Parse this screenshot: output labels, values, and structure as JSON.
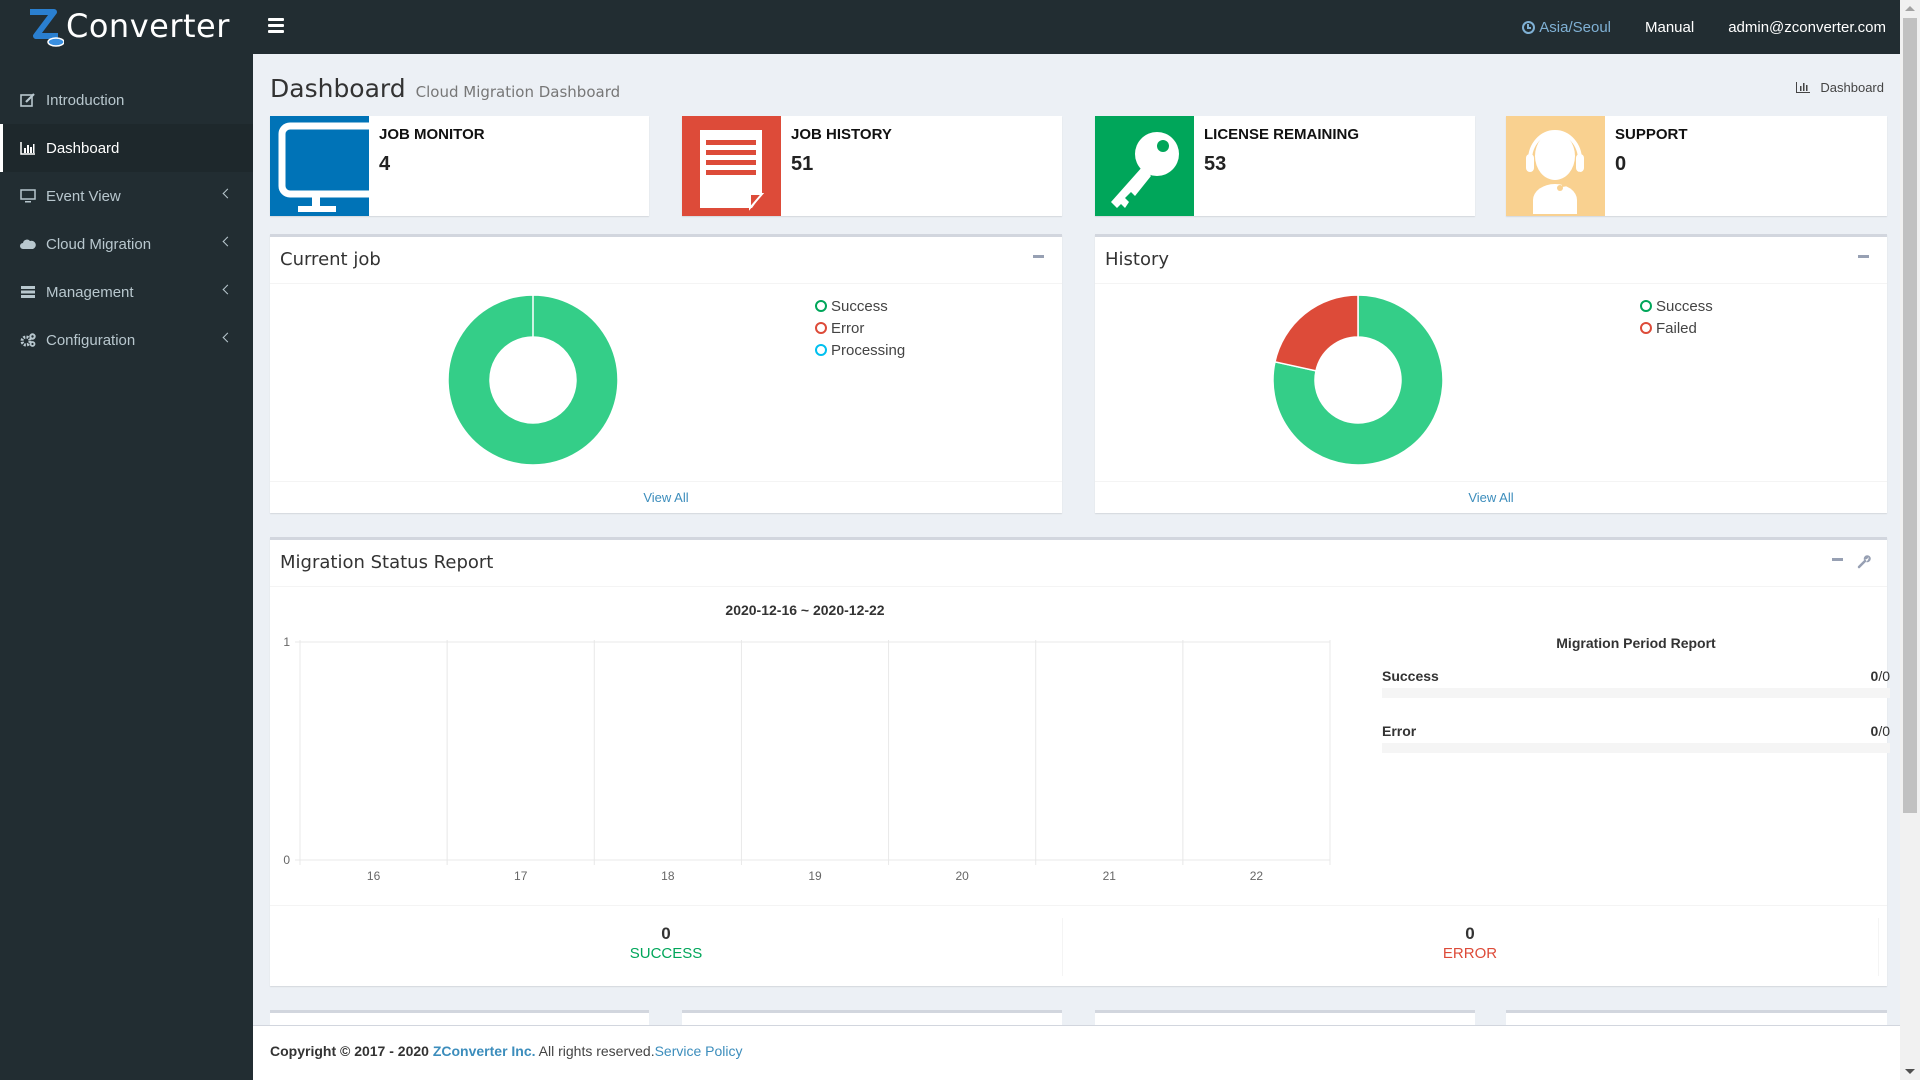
{
  "app": {
    "logo_text": "Converter",
    "logo_letter": "Z"
  },
  "topbar": {
    "timezone": "Asia/Seoul",
    "manual": "Manual",
    "user": "admin@zconverter.com"
  },
  "sidebar": {
    "items": [
      {
        "label": "Introduction",
        "icon": "edit-icon",
        "active": false,
        "has_submenu": false
      },
      {
        "label": "Dashboard",
        "icon": "bar-chart-icon",
        "active": true,
        "has_submenu": false
      },
      {
        "label": "Event View",
        "icon": "monitor-icon",
        "active": false,
        "has_submenu": true
      },
      {
        "label": "Cloud Migration",
        "icon": "cloud-icon",
        "active": false,
        "has_submenu": true
      },
      {
        "label": "Management",
        "icon": "server-icon",
        "active": false,
        "has_submenu": true
      },
      {
        "label": "Configuration",
        "icon": "cogs-icon",
        "active": false,
        "has_submenu": true
      }
    ]
  },
  "page": {
    "title": "Dashboard",
    "subtitle": "Cloud Migration Dashboard",
    "breadcrumb": "Dashboard"
  },
  "info_boxes": [
    {
      "label": "JOB MONITOR",
      "value": "4",
      "icon": "monitor-icon",
      "color": "#0073b7"
    },
    {
      "label": "JOB HISTORY",
      "value": "51",
      "icon": "document-icon",
      "color": "#dd4b39"
    },
    {
      "label": "LICENSE REMAINING",
      "value": "53",
      "icon": "key-icon",
      "color": "#00a65a"
    },
    {
      "label": "SUPPORT",
      "value": "0",
      "icon": "headset-icon",
      "color": "#f9d190"
    }
  ],
  "current_job": {
    "title": "Current job",
    "view_all": "View All",
    "legend": [
      {
        "label": "Success",
        "color": "#00a65a"
      },
      {
        "label": "Error",
        "color": "#dd4b39"
      },
      {
        "label": "Processing",
        "color": "#00c0ef"
      }
    ]
  },
  "history": {
    "title": "History",
    "view_all": "View All",
    "legend": [
      {
        "label": "Success",
        "color": "#00a65a"
      },
      {
        "label": "Failed",
        "color": "#dd4b39"
      }
    ]
  },
  "migration": {
    "title": "Migration Status Report",
    "period_report_title": "Migration Period Report",
    "progress": [
      {
        "label": "Success",
        "done": "0",
        "total": "0",
        "fraction": 0
      },
      {
        "label": "Error",
        "done": "0",
        "total": "0",
        "fraction": 0
      }
    ],
    "stats": [
      {
        "value": "0",
        "label": "SUCCESS",
        "color": "#00a65a"
      },
      {
        "value": "0",
        "label": "ERROR",
        "color": "#dd4b39"
      }
    ]
  },
  "footer": {
    "prefix": "Copyright © 2017 - 2020 ",
    "company": "ZConverter Inc.",
    "rights": " All rights reserved.",
    "policy": "Service Policy"
  },
  "chart_data": [
    {
      "type": "pie",
      "title": "Current job",
      "donut": true,
      "categories": [
        "Success",
        "Error",
        "Processing"
      ],
      "values": [
        4,
        0,
        0
      ],
      "colors": [
        "#34ce88",
        "#dd4b39",
        "#00c0ef"
      ]
    },
    {
      "type": "pie",
      "title": "History",
      "donut": true,
      "categories": [
        "Success",
        "Failed"
      ],
      "values": [
        40,
        11
      ],
      "colors": [
        "#34ce88",
        "#dd4b39"
      ]
    },
    {
      "type": "line",
      "title": "2020-12-16 ~ 2020-12-22",
      "x": [
        "16",
        "17",
        "18",
        "19",
        "20",
        "21",
        "22"
      ],
      "series": [
        {
          "name": "Success",
          "values": [
            0,
            0,
            0,
            0,
            0,
            0,
            0
          ]
        },
        {
          "name": "Error",
          "values": [
            0,
            0,
            0,
            0,
            0,
            0,
            0
          ]
        }
      ],
      "yticks": [
        "0",
        "1"
      ],
      "ylim": [
        0,
        1
      ],
      "grid": true
    }
  ]
}
